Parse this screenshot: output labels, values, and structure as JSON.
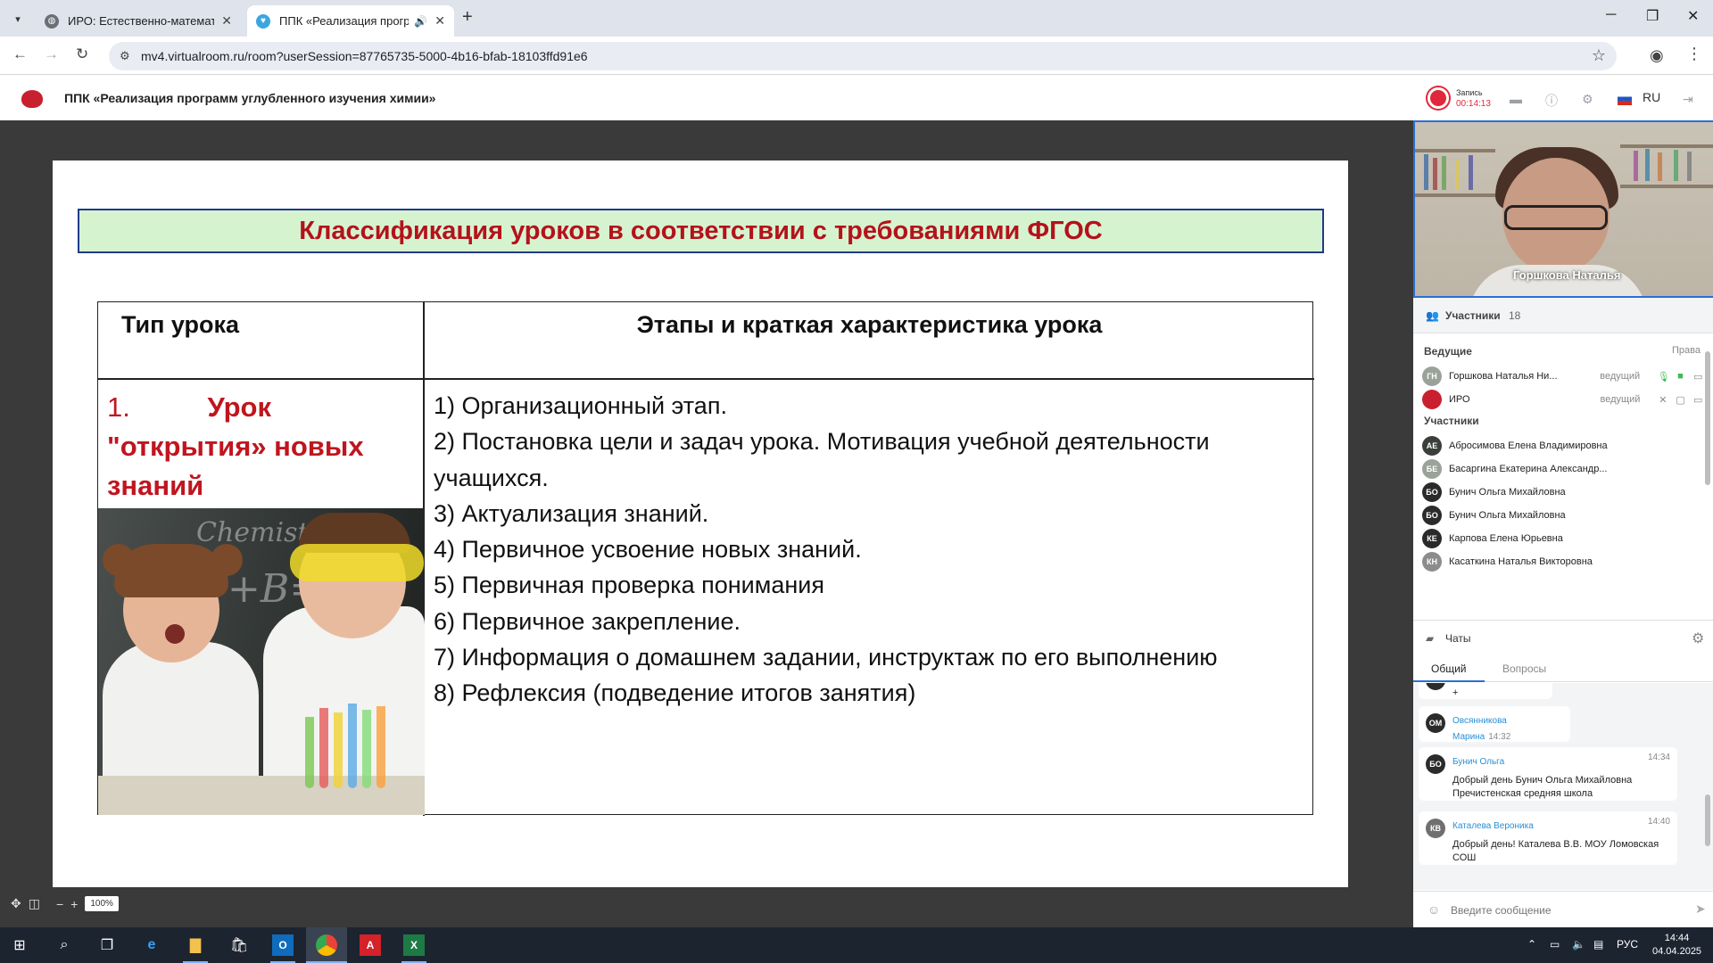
{
  "browser": {
    "tabs": [
      {
        "title": "ИРО: Естественно-математиче",
        "active": false
      },
      {
        "title": "ППК «Реализация програм",
        "active": true
      }
    ],
    "url": "mv4.virtualroom.ru/room?userSession=87765735-5000-4b16-bfab-18103ffd91e6"
  },
  "app": {
    "title": "ППК «Реализация программ углубленного изучения химии»",
    "recording_label": "Запись",
    "recording_time": "00:14:13",
    "language": "RU"
  },
  "slide": {
    "title": "Классификация  уроков в соответствии с требованиями ФГОС",
    "header_type": "Тип урока",
    "header_stages": "Этапы и краткая характеристика урока",
    "lesson_number": "1.",
    "lesson_name": "Урок \"открытия» новых знаний",
    "stages": [
      "1) Организационный этап.",
      "2)  Постановка цели и задач урока. Мотивация учебной деятельности учащихся.",
      "3) Актуализация знаний.",
      "4) Первичное усвоение новых знаний.",
      "5) Первичная проверка понимания",
      "6) Первичное закрепление.",
      "7)  Информация  о  домашнем задании,  инструктаж   по его выполнению",
      "8) Рефлексия (подведение итогов занятия)"
    ],
    "photo_board_text": [
      "Chemistry",
      "+B=C"
    ]
  },
  "zoom": {
    "value": "100%"
  },
  "video": {
    "name": "Горшкова Наталья"
  },
  "participants": {
    "label": "Участники",
    "count": "18",
    "hosts_label": "Ведущие",
    "rights_label": "Права",
    "members_label": "Участники",
    "hosts": [
      {
        "initials": "ГН",
        "name": "Горшкова Наталья Ни...",
        "role": "ведущий",
        "color": "#9aa39a"
      },
      {
        "initials": "",
        "name": "ИРО",
        "role": "ведущий",
        "color": "#c8202e"
      }
    ],
    "members": [
      {
        "initials": "АЕ",
        "name": "Абросимова Елена Владимировна",
        "color": "#3b3f3b"
      },
      {
        "initials": "БЕ",
        "name": "Басаргина Екатерина Александр...",
        "color": "#9aa39a"
      },
      {
        "initials": "БО",
        "name": "Бунич Ольга Михайловна",
        "color": "#2b2b2b"
      },
      {
        "initials": "БО",
        "name": "Бунич Ольга Михайловна",
        "color": "#2b2b2b"
      },
      {
        "initials": "КЕ",
        "name": "Карпова Елена Юрьевна",
        "color": "#2b2b2b"
      },
      {
        "initials": "КН",
        "name": "Касаткина Наталья Викторовна",
        "color": "#8c8c8c"
      }
    ]
  },
  "chat": {
    "label": "Чаты",
    "tab_general": "Общий",
    "tab_questions": "Вопросы",
    "messages": [
      {
        "initials": "",
        "author": "",
        "time": "",
        "text": "+"
      },
      {
        "initials": "ОМ",
        "author": "Овсянникова Марина",
        "time": "14:32",
        "text": "+"
      },
      {
        "initials": "БО",
        "author": "Бунич Ольга",
        "time": "14:34",
        "text": "Добрый день Бунич Ольга Михайловна Пречистенская средняя школа"
      },
      {
        "initials": "КВ",
        "author": "Каталева Вероника",
        "time": "14:40",
        "text": "Добрый день! Каталева В.В. МОУ Ломовская СОШ"
      }
    ],
    "input_placeholder": "Введите сообщение"
  },
  "taskbar": {
    "lang": "РУС",
    "time": "14:44",
    "date": "04.04.2025"
  }
}
